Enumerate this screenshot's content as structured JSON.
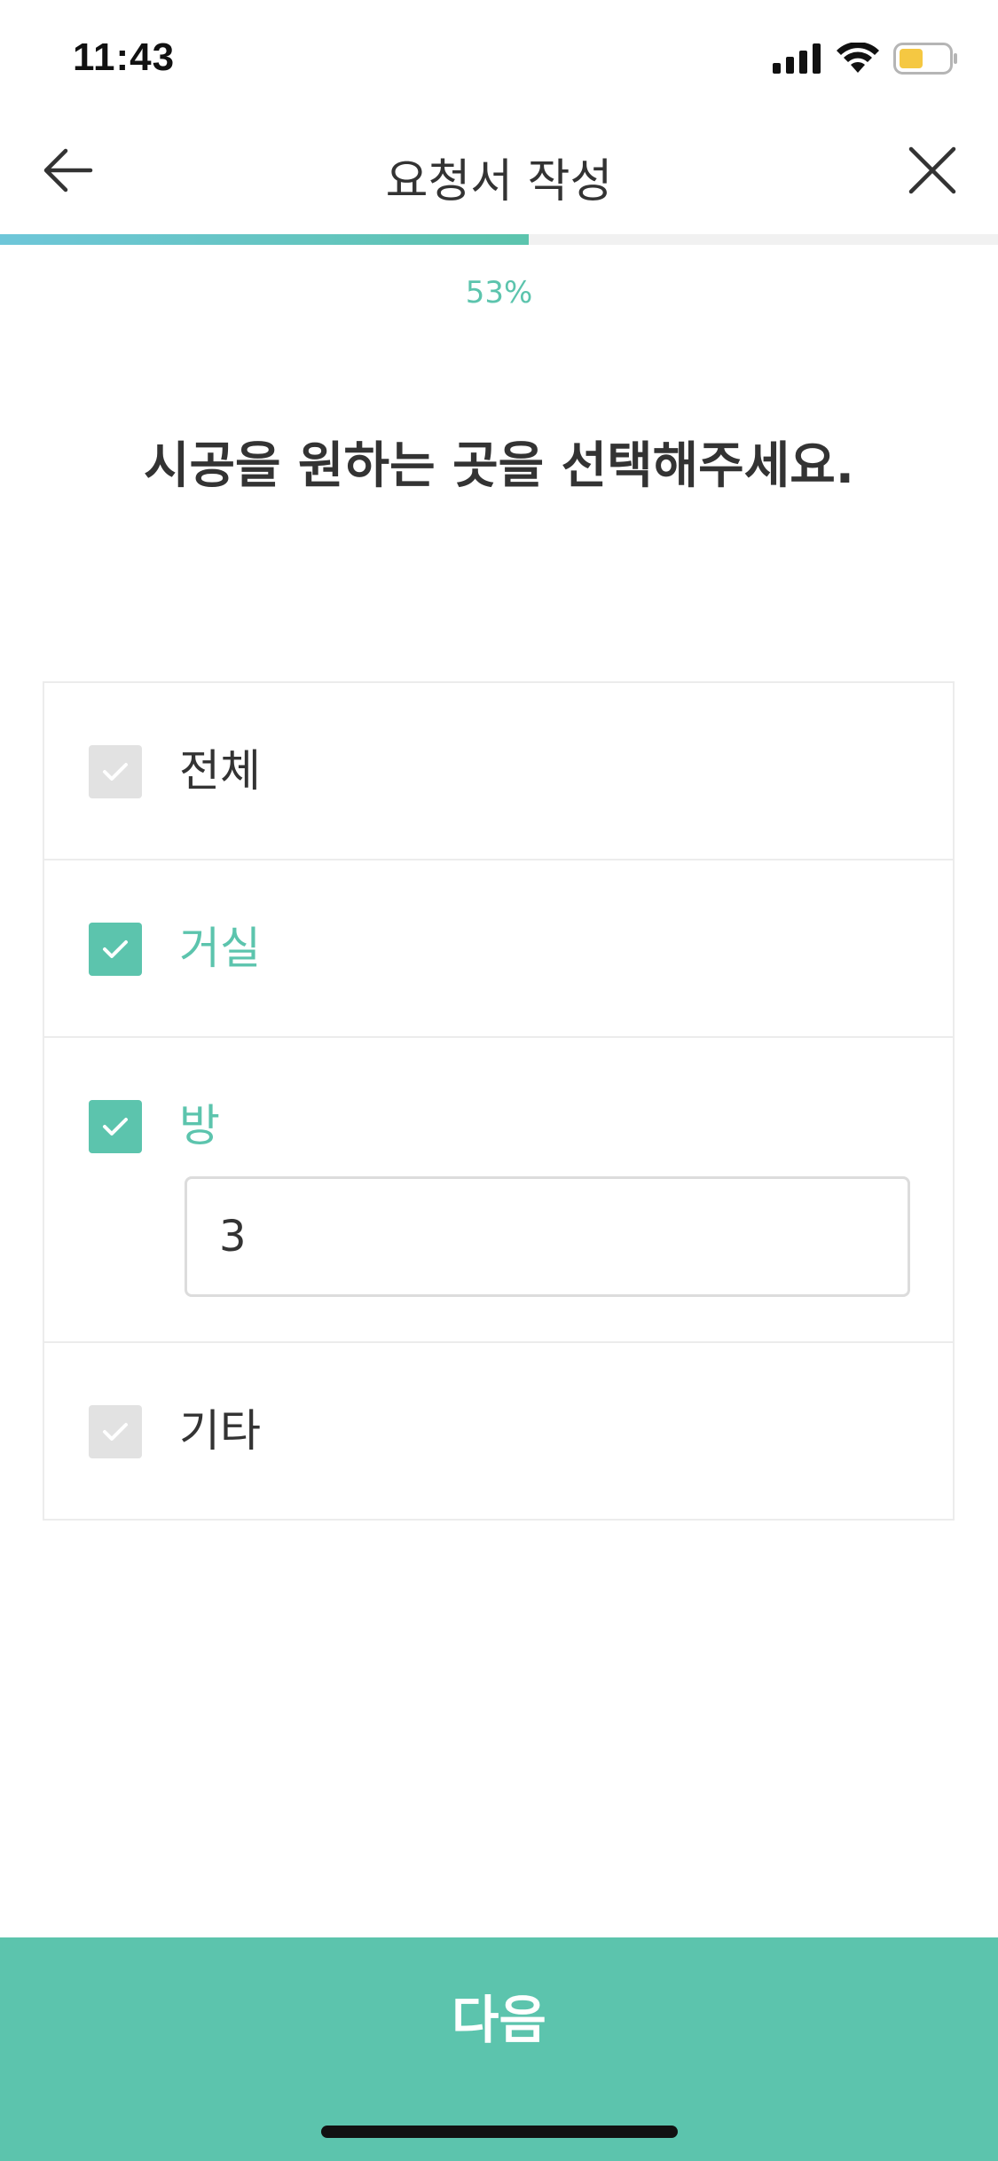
{
  "status_bar": {
    "time": "11:43",
    "icons": [
      "signal-icon",
      "wifi-icon",
      "battery-icon"
    ],
    "battery_color": "#f5c842"
  },
  "nav": {
    "title": "요청서 작성",
    "back_icon": "arrow-left-icon",
    "close_icon": "close-icon"
  },
  "progress": {
    "value": 0.53,
    "label": "53%",
    "color": "#5cc4ad"
  },
  "question": "시공을 원하는 곳을 선택해주세요.",
  "options": [
    {
      "label": "전체",
      "checked": false
    },
    {
      "label": "거실",
      "checked": true
    },
    {
      "label": "방",
      "checked": true,
      "input_value": "3"
    },
    {
      "label": "기타",
      "checked": false
    }
  ],
  "next_button": {
    "label": "다음",
    "color": "#5cc4ad"
  }
}
